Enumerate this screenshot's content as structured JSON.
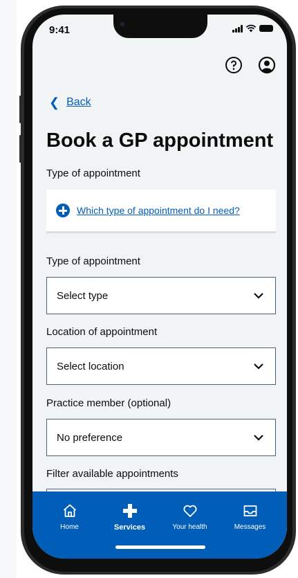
{
  "status_bar": {
    "time": "9:41"
  },
  "header": {
    "help_icon": "question-circle-icon",
    "account_icon": "user-circle-icon"
  },
  "back": {
    "label": "Back"
  },
  "page": {
    "title": "Book a GP appointment",
    "subtitle": "Type of appointment"
  },
  "info_card": {
    "link_text": "Which type of appointment do I need?"
  },
  "fields": [
    {
      "label": "Type of appointment",
      "value": "Select type"
    },
    {
      "label": "Location of appointment",
      "value": "Select location"
    },
    {
      "label": "Practice member (optional)",
      "value": "No preference"
    }
  ],
  "filter": {
    "label": "Filter available appointments"
  },
  "tabs": [
    {
      "label": "Home",
      "icon": "home-icon",
      "active": false
    },
    {
      "label": "Services",
      "icon": "plus-icon",
      "active": true
    },
    {
      "label": "Your health",
      "icon": "heart-icon",
      "active": false
    },
    {
      "label": "Messages",
      "icon": "inbox-icon",
      "active": false
    }
  ],
  "colors": {
    "brand_blue": "#005eb8",
    "screen_background": "#f0f4f5",
    "text": "#0b0c0c",
    "field_border": "#4c6272"
  }
}
